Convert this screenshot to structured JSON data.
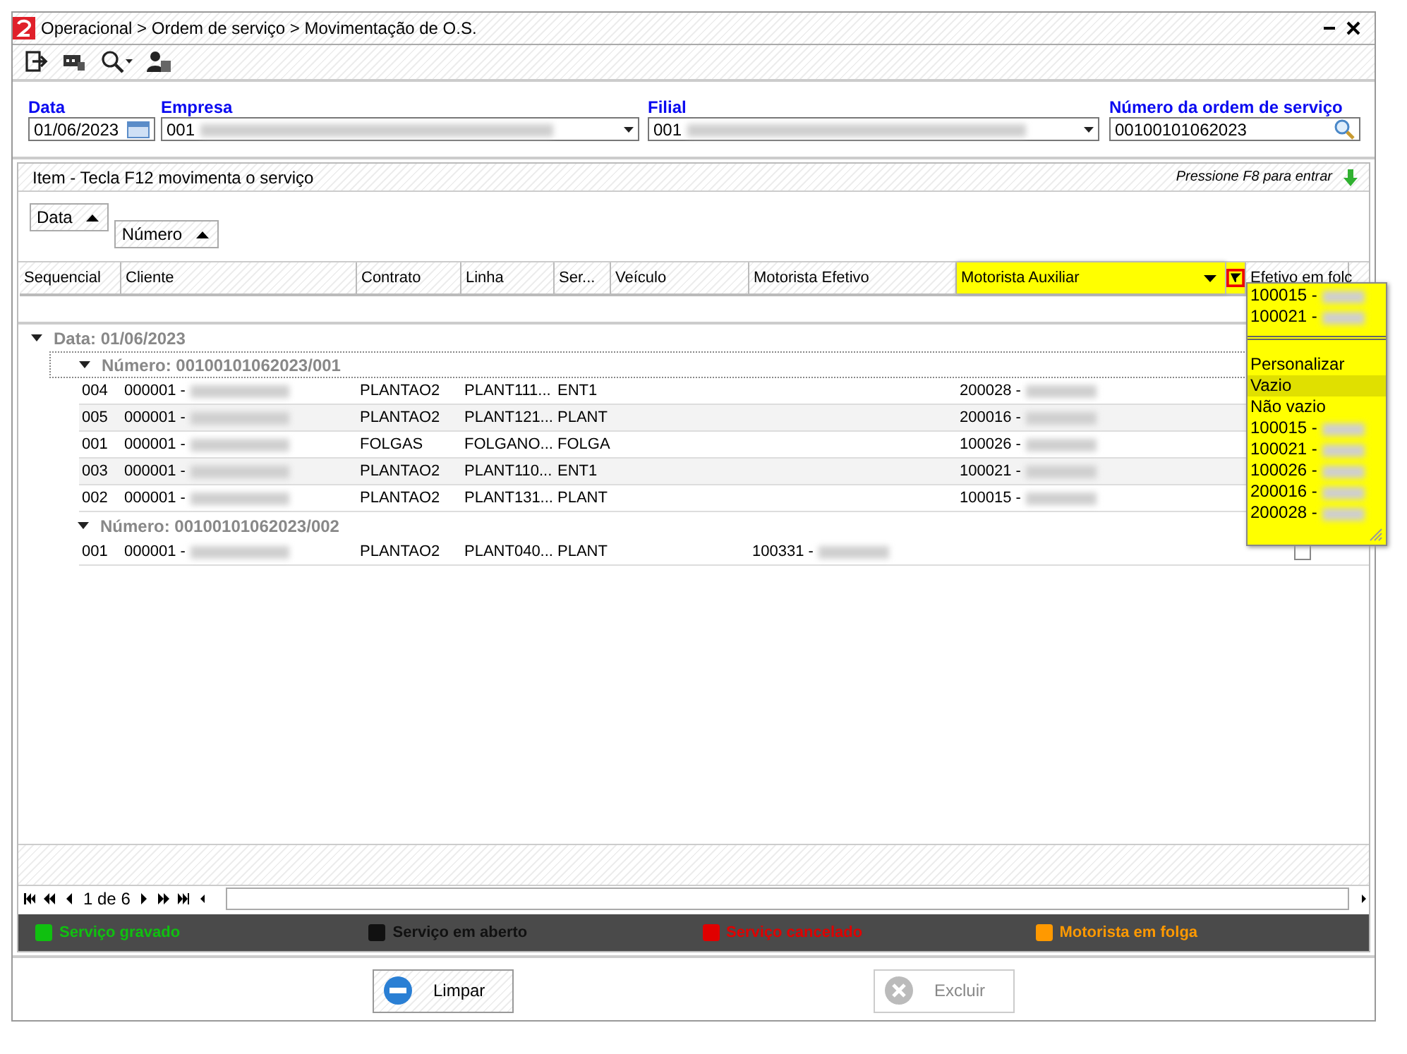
{
  "window": {
    "title": "Operacional > Ordem de serviço > Movimentação de O.S."
  },
  "filters": [
    {
      "label": "Data",
      "value": "01/06/2023",
      "kind": "date"
    },
    {
      "label": "Empresa",
      "value": "001",
      "kind": "combo"
    },
    {
      "label": "Filial",
      "value": "001",
      "kind": "combo"
    },
    {
      "label": "Número da ordem de serviço",
      "value": "00100101062023",
      "kind": "search"
    }
  ],
  "grid": {
    "caption": "Item - Tecla F12 movimenta o serviço",
    "hint": "Pressione F8 para entrar",
    "group_by": [
      {
        "label": "Data"
      },
      {
        "label": "Número"
      }
    ],
    "columns": [
      {
        "label": "Sequencial",
        "selected": false
      },
      {
        "label": "Cliente",
        "selected": false
      },
      {
        "label": "Contrato",
        "selected": false
      },
      {
        "label": "Linha",
        "selected": false
      },
      {
        "label": "Ser...",
        "selected": false
      },
      {
        "label": "Veículo",
        "selected": false
      },
      {
        "label": "Motorista Efetivo",
        "selected": false
      },
      {
        "label": "Motorista Auxiliar",
        "selected": true
      },
      {
        "label": "Efetivo em folc",
        "selected": false
      }
    ],
    "groups": [
      {
        "label": "Data: 01/06/2023",
        "expanded": true,
        "children": [
          {
            "label": "Número: 00100101062023/001",
            "expanded": true,
            "rows": [
              {
                "sequencial": "004",
                "cliente": "000001 -",
                "contrato": "PLANTAO2",
                "linha": "PLANT111...",
                "servico": "ENT1",
                "motorista_auxiliar": "200028 -"
              },
              {
                "sequencial": "005",
                "cliente": "000001 -",
                "contrato": "PLANTAO2",
                "linha": "PLANT121...",
                "servico": "PLANT",
                "motorista_auxiliar": "200016 -"
              },
              {
                "sequencial": "001",
                "cliente": "000001 -",
                "contrato": "FOLGAS",
                "linha": "FOLGANO...",
                "servico": "FOLGA",
                "motorista_auxiliar": "100026 -"
              },
              {
                "sequencial": "003",
                "cliente": "000001 -",
                "contrato": "PLANTAO2",
                "linha": "PLANT110...",
                "servico": "ENT1",
                "motorista_auxiliar": "100021 -"
              },
              {
                "sequencial": "002",
                "cliente": "000001 -",
                "contrato": "PLANTAO2",
                "linha": "PLANT131...",
                "servico": "PLANT",
                "motorista_auxiliar": "100015 -"
              }
            ]
          },
          {
            "label": "Número: 00100101062023/002",
            "expanded": true,
            "rows": [
              {
                "sequencial": "001",
                "cliente": "000001 -",
                "contrato": "PLANTAO2",
                "linha": "PLANT040...",
                "servico": "PLANT",
                "motorista_efetivo": "100331 -",
                "checked": false
              }
            ]
          }
        ]
      }
    ]
  },
  "filter_dropdown": {
    "current": [
      "100015 -",
      "100021 -"
    ],
    "items": [
      {
        "label": "Personalizar",
        "selected": false
      },
      {
        "label": "Vazio",
        "selected": true
      },
      {
        "label": "Não vazio",
        "selected": false
      },
      {
        "label": "100015 -",
        "selected": false
      },
      {
        "label": "100021 -",
        "selected": false
      },
      {
        "label": "100026 -",
        "selected": false
      },
      {
        "label": "200016 -",
        "selected": false
      },
      {
        "label": "200028 -",
        "selected": false
      }
    ]
  },
  "pager": {
    "page": "1 de 6"
  },
  "legend": [
    {
      "label": "Serviço gravado",
      "color": "#10c010"
    },
    {
      "label": "Serviço em aberto",
      "color": "#111111"
    },
    {
      "label": "Serviço cancelado",
      "color": "#e00000"
    },
    {
      "label": "Motorista em folga",
      "color": "#ff9900"
    }
  ],
  "buttons": [
    {
      "label": "Limpar",
      "disabled": false
    },
    {
      "label": "Excluir",
      "disabled": true
    }
  ]
}
